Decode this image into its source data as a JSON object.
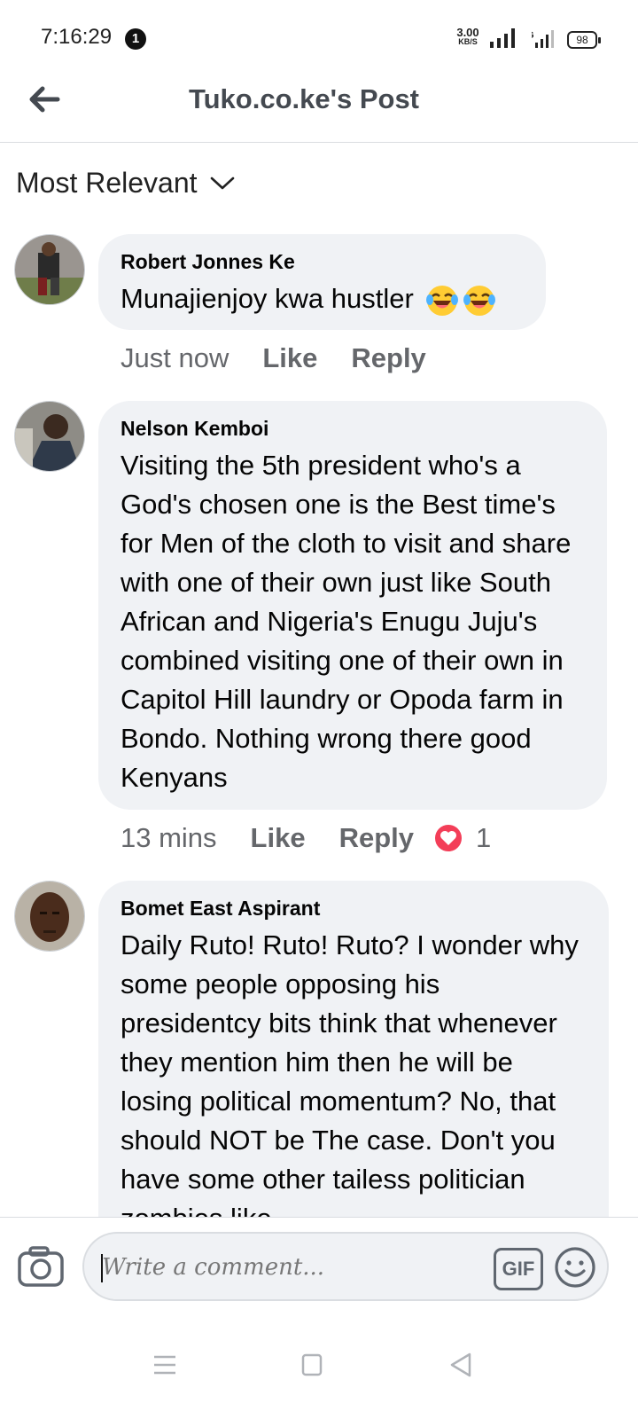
{
  "status_bar": {
    "time": "7:16:29",
    "notification_count": "1",
    "net_speed_value": "3.00",
    "net_speed_unit": "KB/S",
    "network_type": "4G",
    "battery": "98"
  },
  "header": {
    "title": "Tuko.co.ke's Post",
    "back_icon": "back-arrow-icon"
  },
  "sort": {
    "label": "Most Relevant",
    "icon": "chevron-down-icon"
  },
  "comments": [
    {
      "author": "Robert Jonnes Ke",
      "text": "Munajienjoy kwa hustler",
      "emojis": [
        "tears-of-joy-emoji",
        "tears-of-joy-emoji"
      ],
      "time": "Just now",
      "like_label": "Like",
      "reply_label": "Reply"
    },
    {
      "author": "Nelson Kemboi",
      "text": "Visiting the 5th president who's a God's chosen one is the Best time's for Men of the cloth to visit and share with one of their own just like South African and Nigeria's Enugu Juju's combined visiting one of their own in Capitol Hill laundry or Opoda farm in Bondo. Nothing wrong there good Kenyans",
      "time": "13 mins",
      "like_label": "Like",
      "reply_label": "Reply",
      "reaction_icon": "love-reaction-icon",
      "reaction_count": "1"
    },
    {
      "author": "Bomet East Aspirant",
      "text": "Daily Ruto! Ruto! Ruto? I wonder why some people opposing his presidentcy bits think that whenever they mention him then he will be losing political momentum? No, that should NOT be The case. Don't you have some other tailess politician zombies like...",
      "time": "",
      "like_label": "",
      "reply_label": ""
    }
  ],
  "composer": {
    "placeholder": "Write a comment...",
    "gif_label": "GIF",
    "camera_icon": "camera-icon",
    "emoji_icon": "smiley-icon"
  },
  "colors": {
    "bubble": "#f0f2f5",
    "meta_text": "#65676b",
    "love": "#f33e58"
  }
}
